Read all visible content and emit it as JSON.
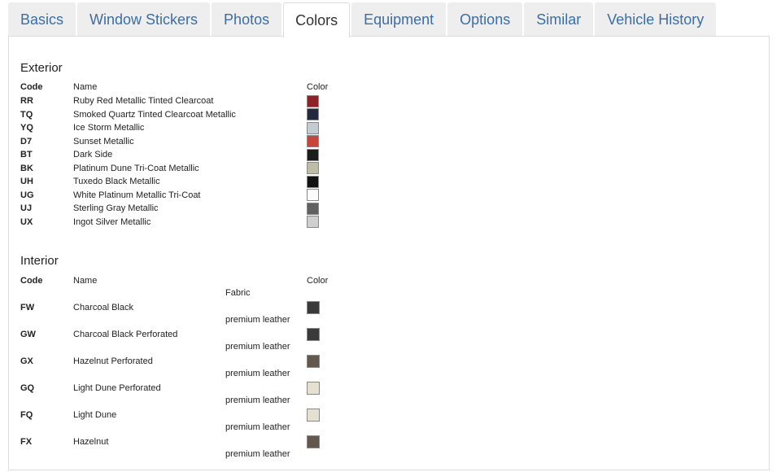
{
  "tabs": [
    {
      "label": "Basics",
      "active": false
    },
    {
      "label": "Window Stickers",
      "active": false
    },
    {
      "label": "Photos",
      "active": false
    },
    {
      "label": "Colors",
      "active": true
    },
    {
      "label": "Equipment",
      "active": false
    },
    {
      "label": "Options",
      "active": false
    },
    {
      "label": "Similar",
      "active": false
    },
    {
      "label": "Vehicle History",
      "active": false
    }
  ],
  "exterior": {
    "title": "Exterior",
    "headers": {
      "code": "Code",
      "name": "Name",
      "color": "Color"
    },
    "rows": [
      {
        "code": "RR",
        "name": "Ruby Red Metallic Tinted Clearcoat",
        "color": "#8c2226"
      },
      {
        "code": "TQ",
        "name": "Smoked Quartz Tinted Clearcoat Metallic",
        "color": "#232a3d"
      },
      {
        "code": "YQ",
        "name": "Ice Storm Metallic",
        "color": "#c3ccd2"
      },
      {
        "code": "D7",
        "name": "Sunset Metallic",
        "color": "#c9443a"
      },
      {
        "code": "BT",
        "name": "Dark Side",
        "color": "#1c1c1c"
      },
      {
        "code": "BK",
        "name": "Platinum Dune Tri-Coat Metallic",
        "color": "#bdbca6"
      },
      {
        "code": "UH",
        "name": "Tuxedo Black Metallic",
        "color": "#121212"
      },
      {
        "code": "UG",
        "name": "White Platinum Metallic Tri-Coat",
        "color": "#ffffff"
      },
      {
        "code": "UJ",
        "name": "Sterling Gray Metallic",
        "color": "#606060"
      },
      {
        "code": "UX",
        "name": "Ingot Silver Metallic",
        "color": "#cfcfcf"
      }
    ]
  },
  "interior": {
    "title": "Interior",
    "headers": {
      "code": "Code",
      "name": "Name",
      "color": "Color"
    },
    "first_material": "Fabric",
    "rows": [
      {
        "code": "FW",
        "name": "Charcoal Black",
        "material_below": "premium leather",
        "color": "#3a3a3a"
      },
      {
        "code": "GW",
        "name": "Charcoal Black Perforated",
        "material_below": "premium leather",
        "color": "#3a3a3a"
      },
      {
        "code": "GX",
        "name": "Hazelnut Perforated",
        "material_below": "premium leather",
        "color": "#63584d"
      },
      {
        "code": "GQ",
        "name": "Light Dune Perforated",
        "material_below": "premium leather",
        "color": "#e5e0cf"
      },
      {
        "code": "FQ",
        "name": "Light Dune",
        "material_below": "premium leather",
        "color": "#e5e0cf"
      },
      {
        "code": "FX",
        "name": "Hazelnut",
        "material_below": "premium leather",
        "color": "#63584d"
      }
    ]
  }
}
